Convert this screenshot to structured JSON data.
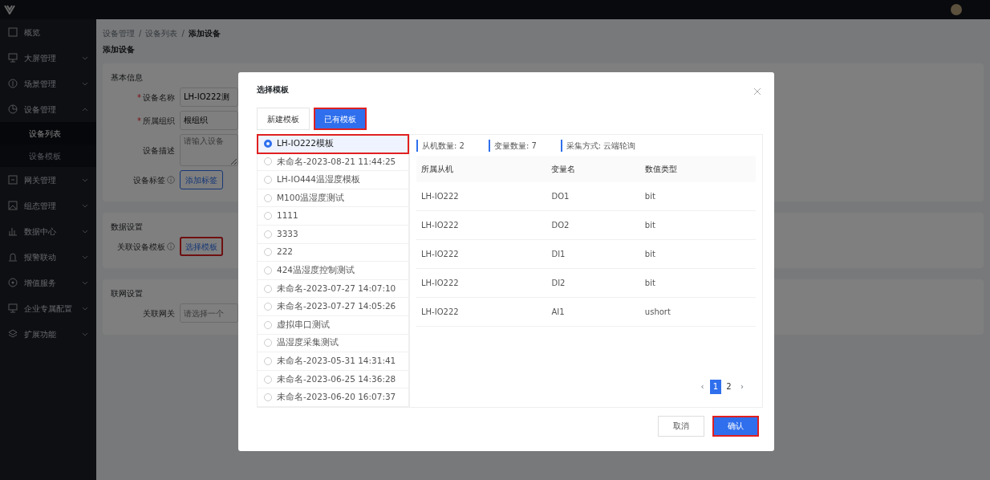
{
  "sidebar": {
    "items": [
      {
        "label": "概览",
        "expandable": false,
        "selected": false
      },
      {
        "label": "大屏管理",
        "expandable": true,
        "expanded": false,
        "selected": false
      },
      {
        "label": "场景管理",
        "expandable": true,
        "expanded": false,
        "selected": false
      },
      {
        "label": "设备管理",
        "expandable": true,
        "expanded": true,
        "selected": false,
        "children": [
          {
            "label": "设备列表",
            "selected": true
          },
          {
            "label": "设备模板",
            "selected": false
          }
        ]
      },
      {
        "label": "网关管理",
        "expandable": true,
        "expanded": false,
        "selected": false
      },
      {
        "label": "组态管理",
        "expandable": true,
        "expanded": false,
        "selected": false
      },
      {
        "label": "数据中心",
        "expandable": true,
        "expanded": false,
        "selected": false
      },
      {
        "label": "报警联动",
        "expandable": true,
        "expanded": false,
        "selected": false
      },
      {
        "label": "增值服务",
        "expandable": true,
        "expanded": false,
        "selected": false
      },
      {
        "label": "企业专属配置",
        "expandable": true,
        "expanded": false,
        "selected": false
      },
      {
        "label": "扩展功能",
        "expandable": true,
        "expanded": false,
        "selected": false
      }
    ]
  },
  "breadcrumb": {
    "separator": "/",
    "items": [
      "设备管理",
      "设备列表",
      "添加设备"
    ]
  },
  "page_title": "添加设备",
  "required_mark": "*",
  "sections": [
    {
      "title": "基本信息",
      "fields": [
        {
          "kind": "input",
          "label": "设备名称",
          "required": true,
          "value": "LH-IO222测"
        },
        {
          "kind": "input",
          "label": "所属组织",
          "required": true,
          "value": "根组织"
        },
        {
          "kind": "textarea",
          "label": "设备描述",
          "required": false,
          "placeholder": "请输入设备"
        },
        {
          "kind": "button",
          "label": "设备标签",
          "required": false,
          "help": true,
          "button": "添加标签",
          "highlighted": false
        }
      ]
    },
    {
      "title": "数据设置",
      "fields": [
        {
          "kind": "button",
          "label": "关联设备模板",
          "required": false,
          "help": true,
          "button": "选择模板",
          "highlighted": true
        }
      ]
    },
    {
      "title": "联网设置",
      "fields": [
        {
          "kind": "input",
          "label": "关联网关",
          "required": false,
          "placeholder": "请选择一个"
        }
      ]
    }
  ],
  "modal": {
    "title": "选择模板",
    "tabs": [
      {
        "label": "新建模板",
        "selected": false,
        "highlighted": false
      },
      {
        "label": "已有模板",
        "selected": true,
        "highlighted": true
      }
    ],
    "templates": [
      {
        "name": "LH-IO222模板",
        "selected": true,
        "highlighted": true
      },
      {
        "name": "未命名-2023-08-21 11:44:25",
        "selected": false,
        "highlighted": false
      },
      {
        "name": "LH-IO444温湿度模板",
        "selected": false,
        "highlighted": false
      },
      {
        "name": "M100温湿度测试",
        "selected": false,
        "highlighted": false
      },
      {
        "name": "1111",
        "selected": false,
        "highlighted": false
      },
      {
        "name": "3333",
        "selected": false,
        "highlighted": false
      },
      {
        "name": "222",
        "selected": false,
        "highlighted": false
      },
      {
        "name": "424温湿度控制测试",
        "selected": false,
        "highlighted": false
      },
      {
        "name": "未命名-2023-07-27 14:07:10",
        "selected": false,
        "highlighted": false
      },
      {
        "name": "未命名-2023-07-27 14:05:26",
        "selected": false,
        "highlighted": false
      },
      {
        "name": "虚拟串口测试",
        "selected": false,
        "highlighted": false
      },
      {
        "name": "温湿度采集测试",
        "selected": false,
        "highlighted": false
      },
      {
        "name": "未命名-2023-05-31 14:31:41",
        "selected": false,
        "highlighted": false
      },
      {
        "name": "未命名-2023-06-25 14:36:28",
        "selected": false,
        "highlighted": false
      },
      {
        "name": "未命名-2023-06-20 16:07:37",
        "selected": false,
        "highlighted": false
      }
    ],
    "stats": [
      {
        "label": "从机数量:",
        "value": "2"
      },
      {
        "label": "变量数量:",
        "value": "7"
      },
      {
        "label": "采集方式:",
        "value": "云端轮询"
      }
    ],
    "table": {
      "columns": [
        "所属从机",
        "变量名",
        "数值类型"
      ],
      "rows": [
        [
          "LH-IO222",
          "DO1",
          "bit"
        ],
        [
          "LH-IO222",
          "DO2",
          "bit"
        ],
        [
          "LH-IO222",
          "DI1",
          "bit"
        ],
        [
          "LH-IO222",
          "DI2",
          "bit"
        ],
        [
          "LH-IO222",
          "AI1",
          "ushort"
        ]
      ]
    },
    "pagination": {
      "prev": "‹",
      "next": "›",
      "pages": [
        {
          "label": "1",
          "selected": true
        },
        {
          "label": "2",
          "selected": false
        }
      ]
    },
    "buttons": [
      {
        "label": "取消",
        "kind": "default",
        "highlighted": false
      },
      {
        "label": "确认",
        "kind": "primary",
        "highlighted": true
      }
    ]
  }
}
